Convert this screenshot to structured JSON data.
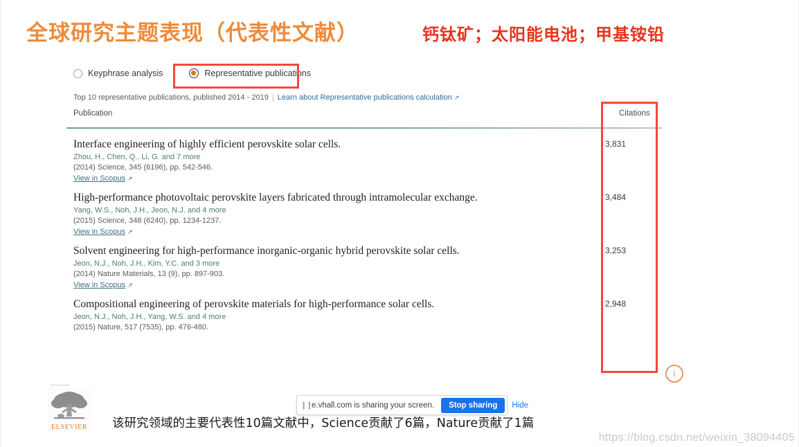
{
  "slide": {
    "title_zh": "全球研究主题表现（代表性文献）",
    "keywords_zh": "钙钛矿；太阳能电池；甲基铵铅",
    "caption_zh": "该研究领域的主要代表性10篇文献中，Science贡献了6篇，Nature贡献了1篇",
    "watermark": "https://blog.csdn.net/weixin_38094405"
  },
  "panel": {
    "options": [
      {
        "label": "Keyphrase analysis",
        "selected": false
      },
      {
        "label": "Representative publications",
        "selected": true
      }
    ],
    "sub_caption": "Top 10 representative publications, published 2014 - 2019",
    "learn_link": "Learn about Representative publications calculation",
    "columns": {
      "publication": "Publication",
      "citations": "Citations"
    },
    "view_link_label": "View in Scopus",
    "info_icon_label": "i",
    "publications": [
      {
        "title": "Interface engineering of highly efficient perovskite solar cells.",
        "authors": "Zhou, H., Chen, Q., Li, G. and 7 more",
        "source": "(2014) Science, 345 (6196), pp. 542-546.",
        "citations": "3,831"
      },
      {
        "title": "High-performance photovoltaic perovskite layers fabricated through intramolecular exchange.",
        "authors": "Yang, W.S., Noh, J.H., Jeon, N.J. and 4 more",
        "source": "(2015) Science, 348 (6240), pp. 1234-1237.",
        "citations": "3,484"
      },
      {
        "title": "Solvent engineering for high-performance inorganic-organic hybrid perovskite solar cells.",
        "authors": "Jeon, N.J., Noh, J.H., Kim, Y.C. and 3 more",
        "source": "(2014) Nature Materials, 13 (9), pp. 897-903.",
        "citations": "3,253"
      },
      {
        "title": "Compositional engineering of perovskite materials for high-performance solar cells.",
        "authors": "Jeon, N.J., Noh, J.H., Yang, W.S. and 4 more",
        "source": "(2015) Nature, 517 (7535), pp. 476-480.",
        "citations": "2,948"
      }
    ]
  },
  "logo": {
    "wordmark": "ELSEVIER"
  },
  "share_bar": {
    "message": "e.vhall.com is sharing your screen.",
    "stop_label": "Stop sharing",
    "hide_label": "Hide"
  },
  "colors": {
    "title_orange": "#ED8B3A",
    "keyword_red": "#E8331C",
    "annotation_red": "#F4473B",
    "radio_orange": "#E9711C",
    "rule_teal": "#6E9EA5",
    "link_blue": "#2B6D9E",
    "author_green": "#4E7E62",
    "share_blue": "#1A73E8",
    "elsevier_orange": "#E8802B"
  }
}
